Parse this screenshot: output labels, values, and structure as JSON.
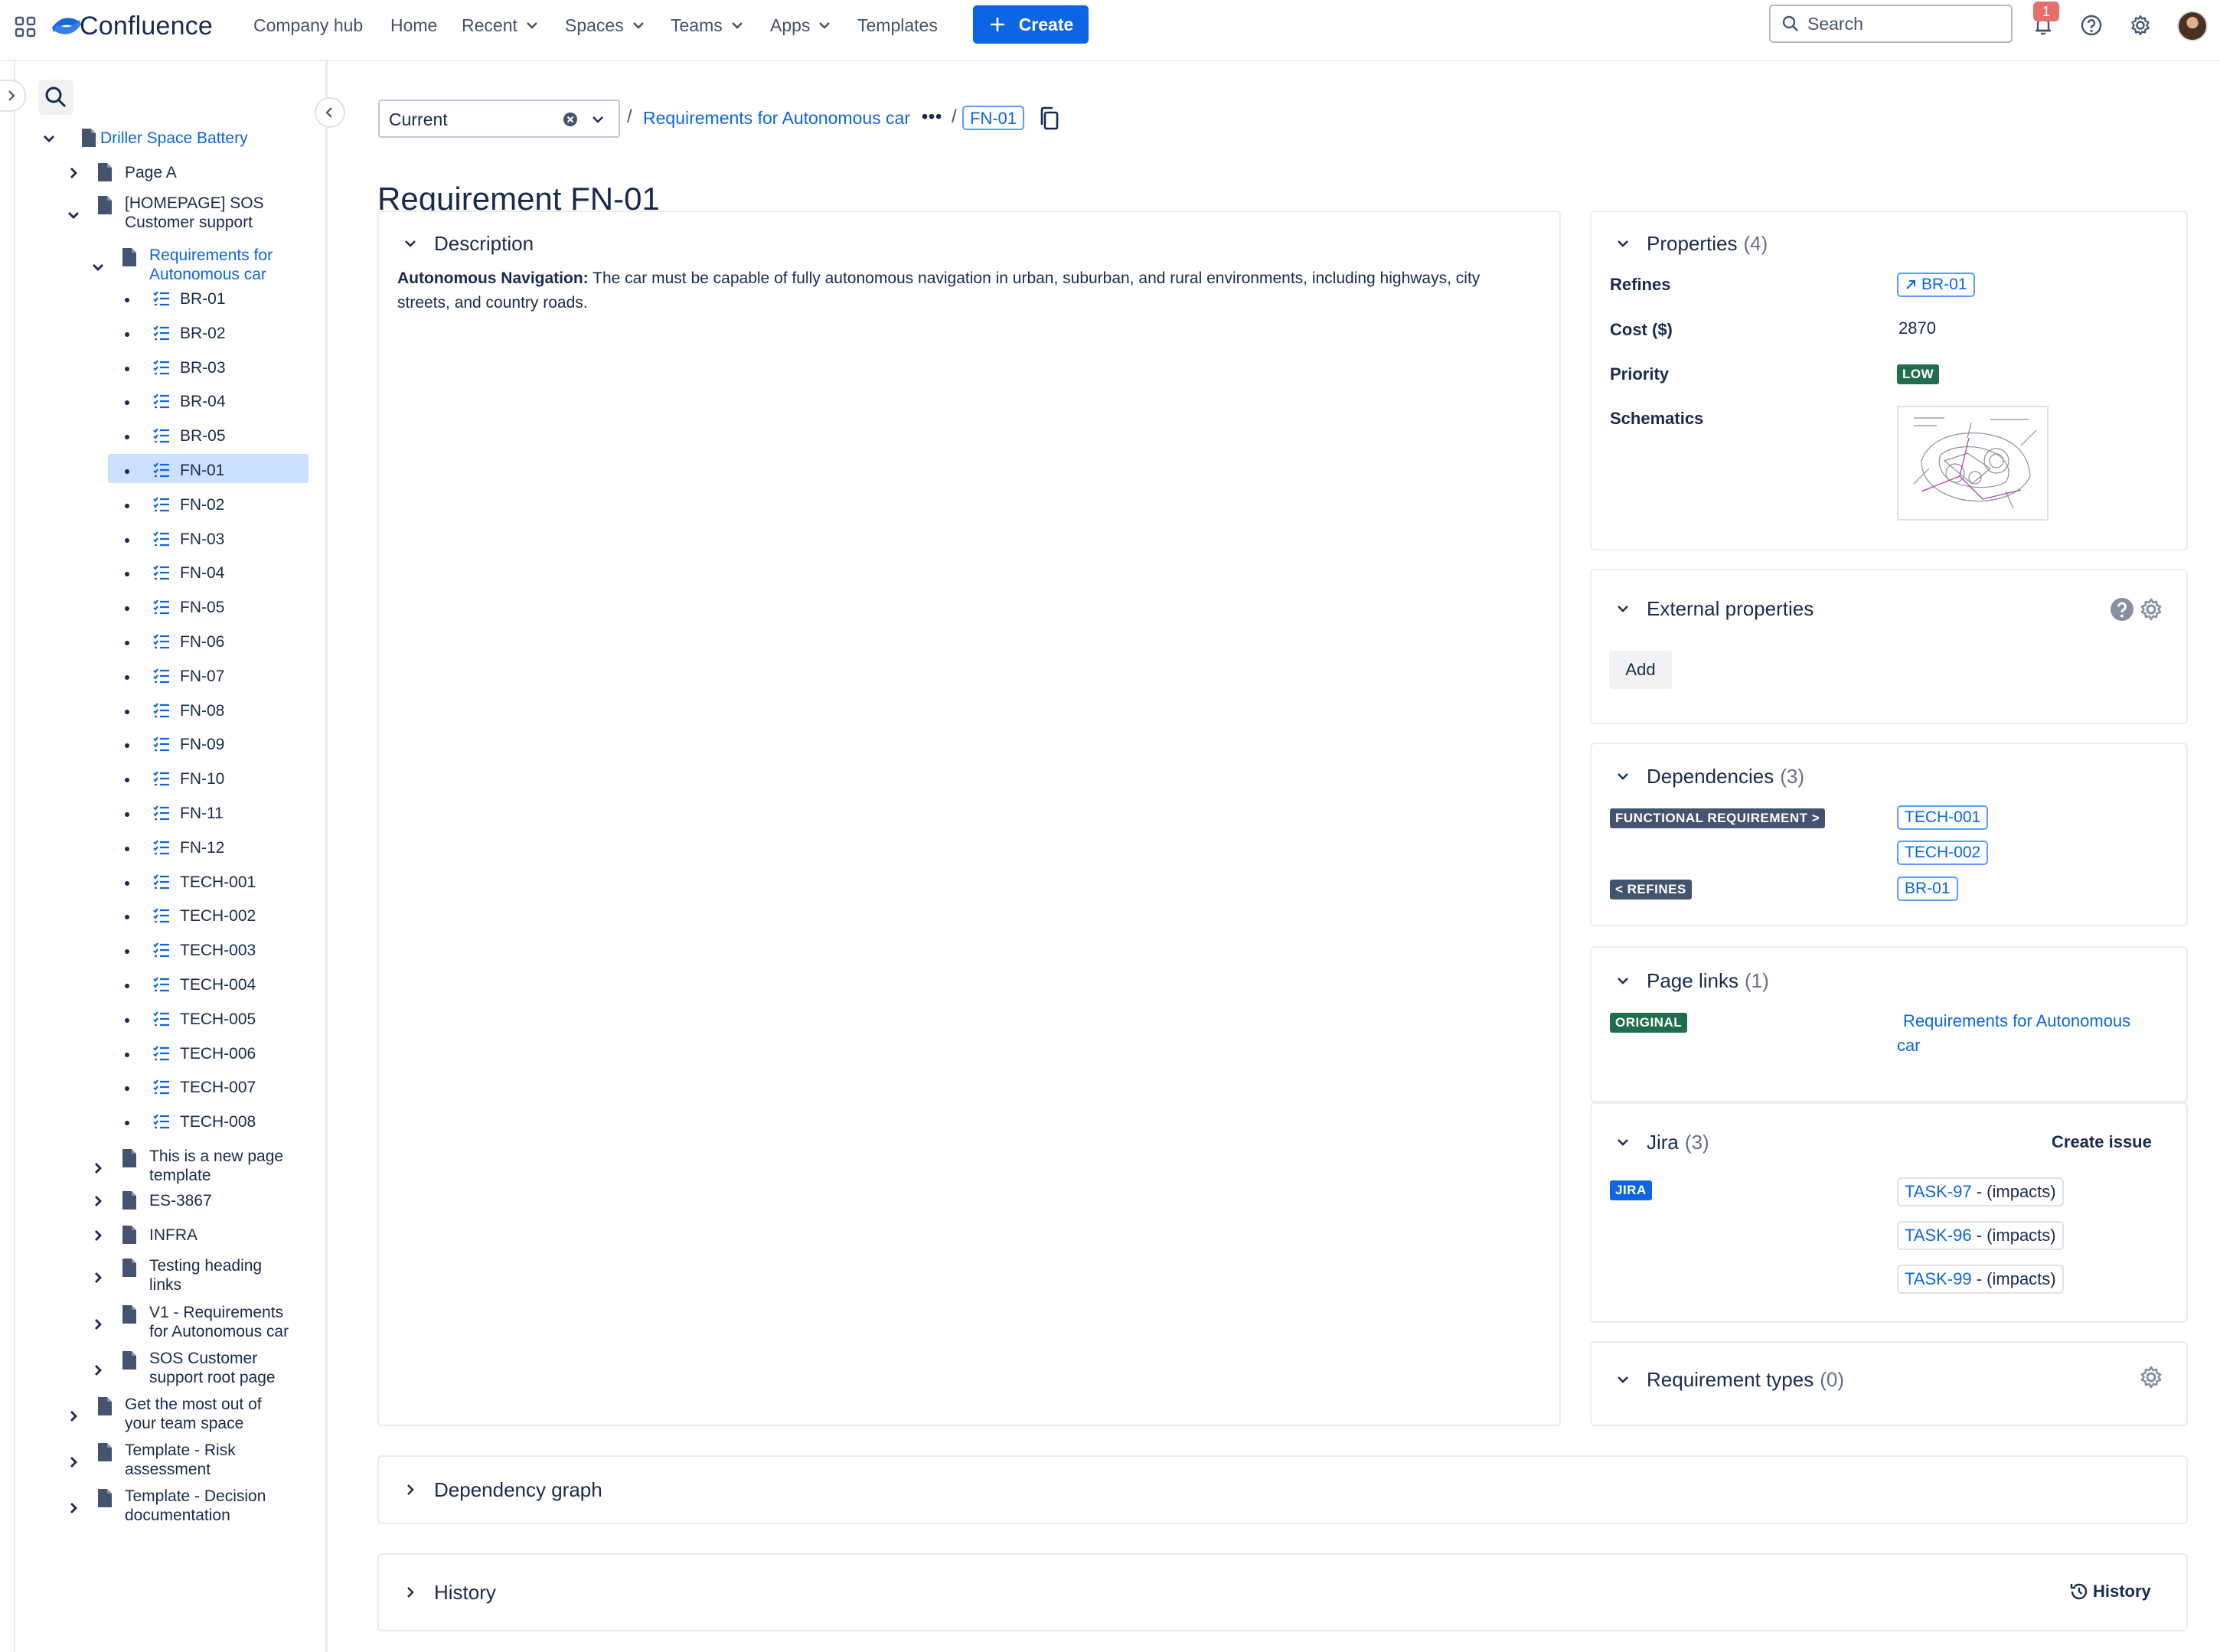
{
  "topbar": {
    "brand": "Confluence",
    "nav": [
      {
        "label": "Company hub"
      },
      {
        "label": "Home"
      },
      {
        "label": "Recent"
      },
      {
        "label": "Spaces"
      },
      {
        "label": "Teams"
      },
      {
        "label": "Apps"
      },
      {
        "label": "Templates"
      }
    ],
    "create_label": "Create",
    "search_placeholder": "Search",
    "notification_count": "1"
  },
  "sidebar": {
    "tree": [
      {
        "label": "Driller Space Battery"
      },
      {
        "label": "Page A"
      },
      {
        "label": "[HOMEPAGE] SOS Customer support",
        "lines": [
          "[HOMEPAGE] SOS",
          "Customer support"
        ]
      },
      {
        "label": "Requirements for Autonomous car",
        "lines": [
          "Requirements for",
          "Autonomous car"
        ]
      },
      {
        "label": "This is a new page template",
        "lines": [
          "This is a new page",
          "template"
        ]
      },
      {
        "label": "ES-3867"
      },
      {
        "label": "INFRA"
      },
      {
        "label": "Testing heading links",
        "lines": [
          "Testing heading",
          "links"
        ]
      },
      {
        "label": "V1 - Requirements for Autonomous car",
        "lines": [
          "V1 - Requirements",
          "for Autonomous car"
        ]
      },
      {
        "label": "SOS Customer support root page",
        "lines": [
          "SOS Customer",
          "support root page"
        ]
      },
      {
        "label": "Get the most out of your team space",
        "lines": [
          "Get the most out of",
          "your team space"
        ]
      },
      {
        "label": "Template - Risk assessment",
        "lines": [
          "Template - Risk",
          "assessment"
        ]
      },
      {
        "label": "Template - Decision documentation",
        "lines": [
          "Template - Decision",
          "documentation"
        ]
      }
    ],
    "requirements": [
      "BR-01",
      "BR-02",
      "BR-03",
      "BR-04",
      "BR-05",
      "FN-01",
      "FN-02",
      "FN-03",
      "FN-04",
      "FN-05",
      "FN-06",
      "FN-07",
      "FN-08",
      "FN-09",
      "FN-10",
      "FN-11",
      "FN-12",
      "TECH-001",
      "TECH-002",
      "TECH-003",
      "TECH-004",
      "TECH-005",
      "TECH-006",
      "TECH-007",
      "TECH-008"
    ],
    "selected": "FN-01"
  },
  "breadcrumb": {
    "version": "Current",
    "parent": "Requirements for Autonomous car",
    "more": "•••",
    "current": "FN-01"
  },
  "page": {
    "title": "Requirement FN-01",
    "description": {
      "heading": "Description",
      "bold": "Autonomous Navigation:",
      "text": " The car must be capable of fully autonomous navigation in urban, suburban, and rural environments, including highways, city streets, and country roads."
    }
  },
  "properties": {
    "heading": "Properties",
    "count": "(4)",
    "refines_label": "Refines",
    "refines_value": "BR-01",
    "cost_label": "Cost ($)",
    "cost_value": "2870",
    "priority_label": "Priority",
    "priority_value": "LOW",
    "schematics_label": "Schematics"
  },
  "external": {
    "heading": "External properties",
    "add_label": "Add"
  },
  "dependencies": {
    "heading": "Dependencies",
    "count": "(3)",
    "groups": [
      {
        "type": "FUNCTIONAL REQUIREMENT >",
        "items": [
          "TECH-001",
          "TECH-002"
        ]
      },
      {
        "type": "< REFINES",
        "items": [
          "BR-01"
        ]
      }
    ]
  },
  "page_links": {
    "heading": "Page links",
    "count": "(1)",
    "type": "ORIGINAL",
    "link_lines": [
      "Requirements for Autonomous",
      "car"
    ]
  },
  "jira": {
    "heading": "Jira",
    "count": "(3)",
    "create_issue": "Create issue",
    "type": "JIRA",
    "issues": [
      {
        "key": "TASK-97",
        "relation": " - (impacts)"
      },
      {
        "key": "TASK-96",
        "relation": " - (impacts)"
      },
      {
        "key": "TASK-99",
        "relation": " - (impacts)"
      }
    ]
  },
  "req_types": {
    "heading": "Requirement types",
    "count": "(0)"
  },
  "dependency_graph": {
    "heading": "Dependency graph"
  },
  "history": {
    "heading": "History",
    "link": "History"
  },
  "colors": {
    "primary": "#0c66e4",
    "selected_bg": "#cce0ff",
    "low_lozenge": "#216e4e",
    "dark_lozenge": "#44546f",
    "notification": "#e5706b"
  }
}
